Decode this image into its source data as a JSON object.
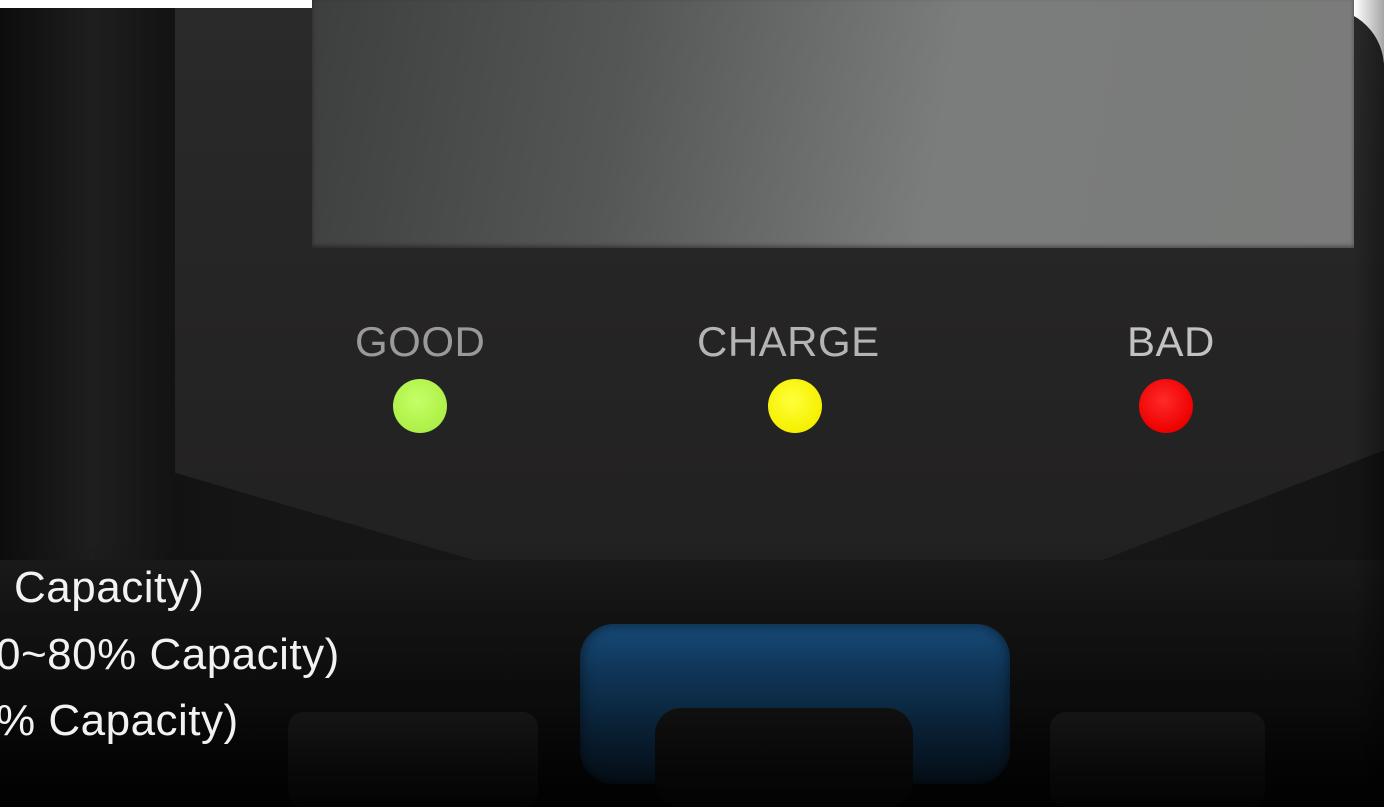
{
  "indicators": [
    {
      "label": "GOOD",
      "color": "#b3f75a"
    },
    {
      "label": "CHARGE",
      "color": "#ffff00"
    },
    {
      "label": "BAD",
      "color": "#ff0000"
    }
  ],
  "captions": [
    " Capacity)",
    "0~80% Capacity)",
    "% Capacity)"
  ],
  "colors": {
    "device_body": "#1b1b1b",
    "screen": "#6e7070",
    "blue_button": "#1d5d96"
  }
}
